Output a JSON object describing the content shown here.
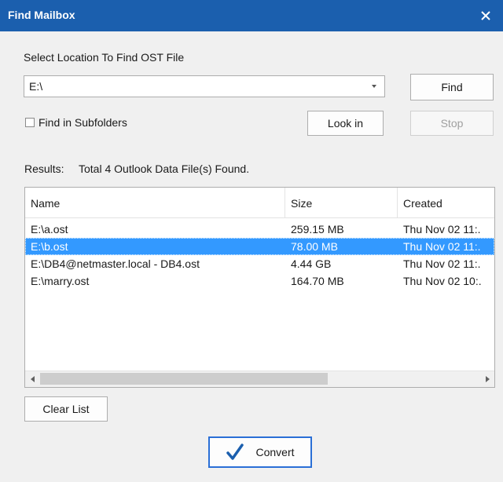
{
  "window": {
    "title": "Find Mailbox"
  },
  "location": {
    "label": "Select Location To Find OST File",
    "value": "E:\\"
  },
  "buttons": {
    "find": "Find",
    "look_in": "Look in",
    "stop": "Stop",
    "clear_list": "Clear List",
    "convert": "Convert"
  },
  "subfolders": {
    "label": "Find in Subfolders",
    "checked": false
  },
  "results": {
    "prefix": "Results:",
    "summary": "Total 4 Outlook Data File(s) Found."
  },
  "table": {
    "columns": [
      "Name",
      "Size",
      "Created"
    ],
    "rows": [
      {
        "name": "E:\\a.ost",
        "size": "259.15 MB",
        "created": "Thu Nov 02 11:.",
        "selected": false
      },
      {
        "name": "E:\\b.ost",
        "size": "78.00 MB",
        "created": "Thu Nov 02 11:.",
        "selected": true
      },
      {
        "name": "E:\\DB4@netmaster.local - DB4.ost",
        "size": "4.44 GB",
        "created": "Thu Nov 02 11:.",
        "selected": false
      },
      {
        "name": "E:\\marry.ost",
        "size": "164.70 MB",
        "created": "Thu Nov 02 10:.",
        "selected": false
      }
    ]
  },
  "icons": {
    "close": "close-icon",
    "dropdown": "chevron-down-icon",
    "convert": "checkmark-icon",
    "scroll_left": "arrow-left-icon",
    "scroll_right": "arrow-right-icon"
  },
  "colors": {
    "titlebar": "#1b5fae",
    "selection": "#3399ff",
    "accent": "#2a6fd6"
  }
}
